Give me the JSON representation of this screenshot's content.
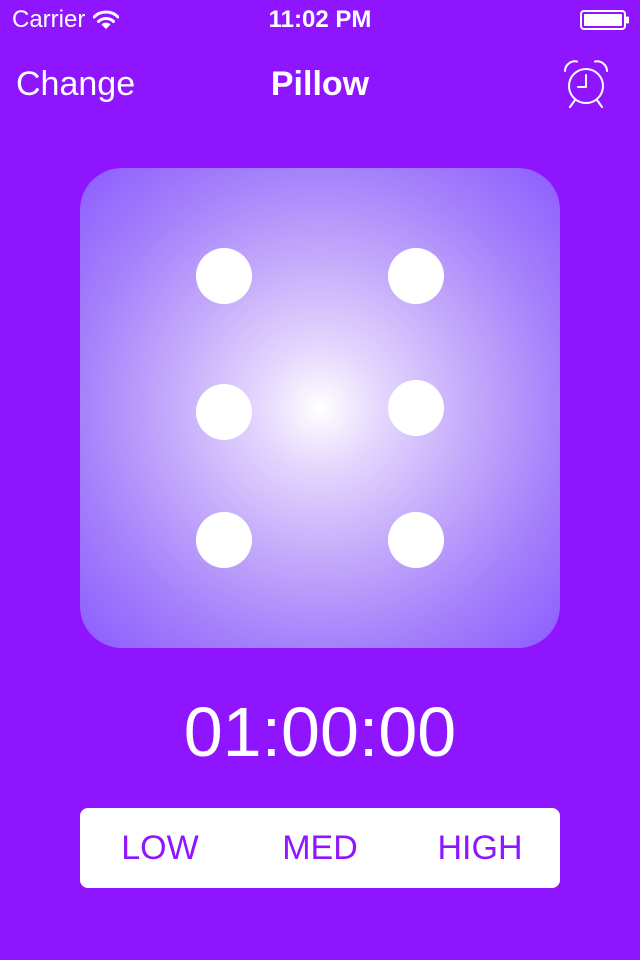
{
  "status_bar": {
    "carrier": "Carrier",
    "time": "11:02 PM",
    "signal_icon": "wifi-icon",
    "battery_icon": "battery-icon"
  },
  "nav": {
    "left_button": "Change",
    "title": "Pillow",
    "right_icon": "alarm-clock-icon"
  },
  "die": {
    "face_value": 6,
    "pip_color": "#ffffff",
    "gradient_center": "#ffffff",
    "gradient_edge": "#8c5cff"
  },
  "timer": {
    "value": "01:00:00"
  },
  "intensity": {
    "options": [
      "LOW",
      "MED",
      "HIGH"
    ]
  },
  "colors": {
    "background": "#8f15ff",
    "accent": "#8f15ff",
    "text": "#ffffff"
  }
}
